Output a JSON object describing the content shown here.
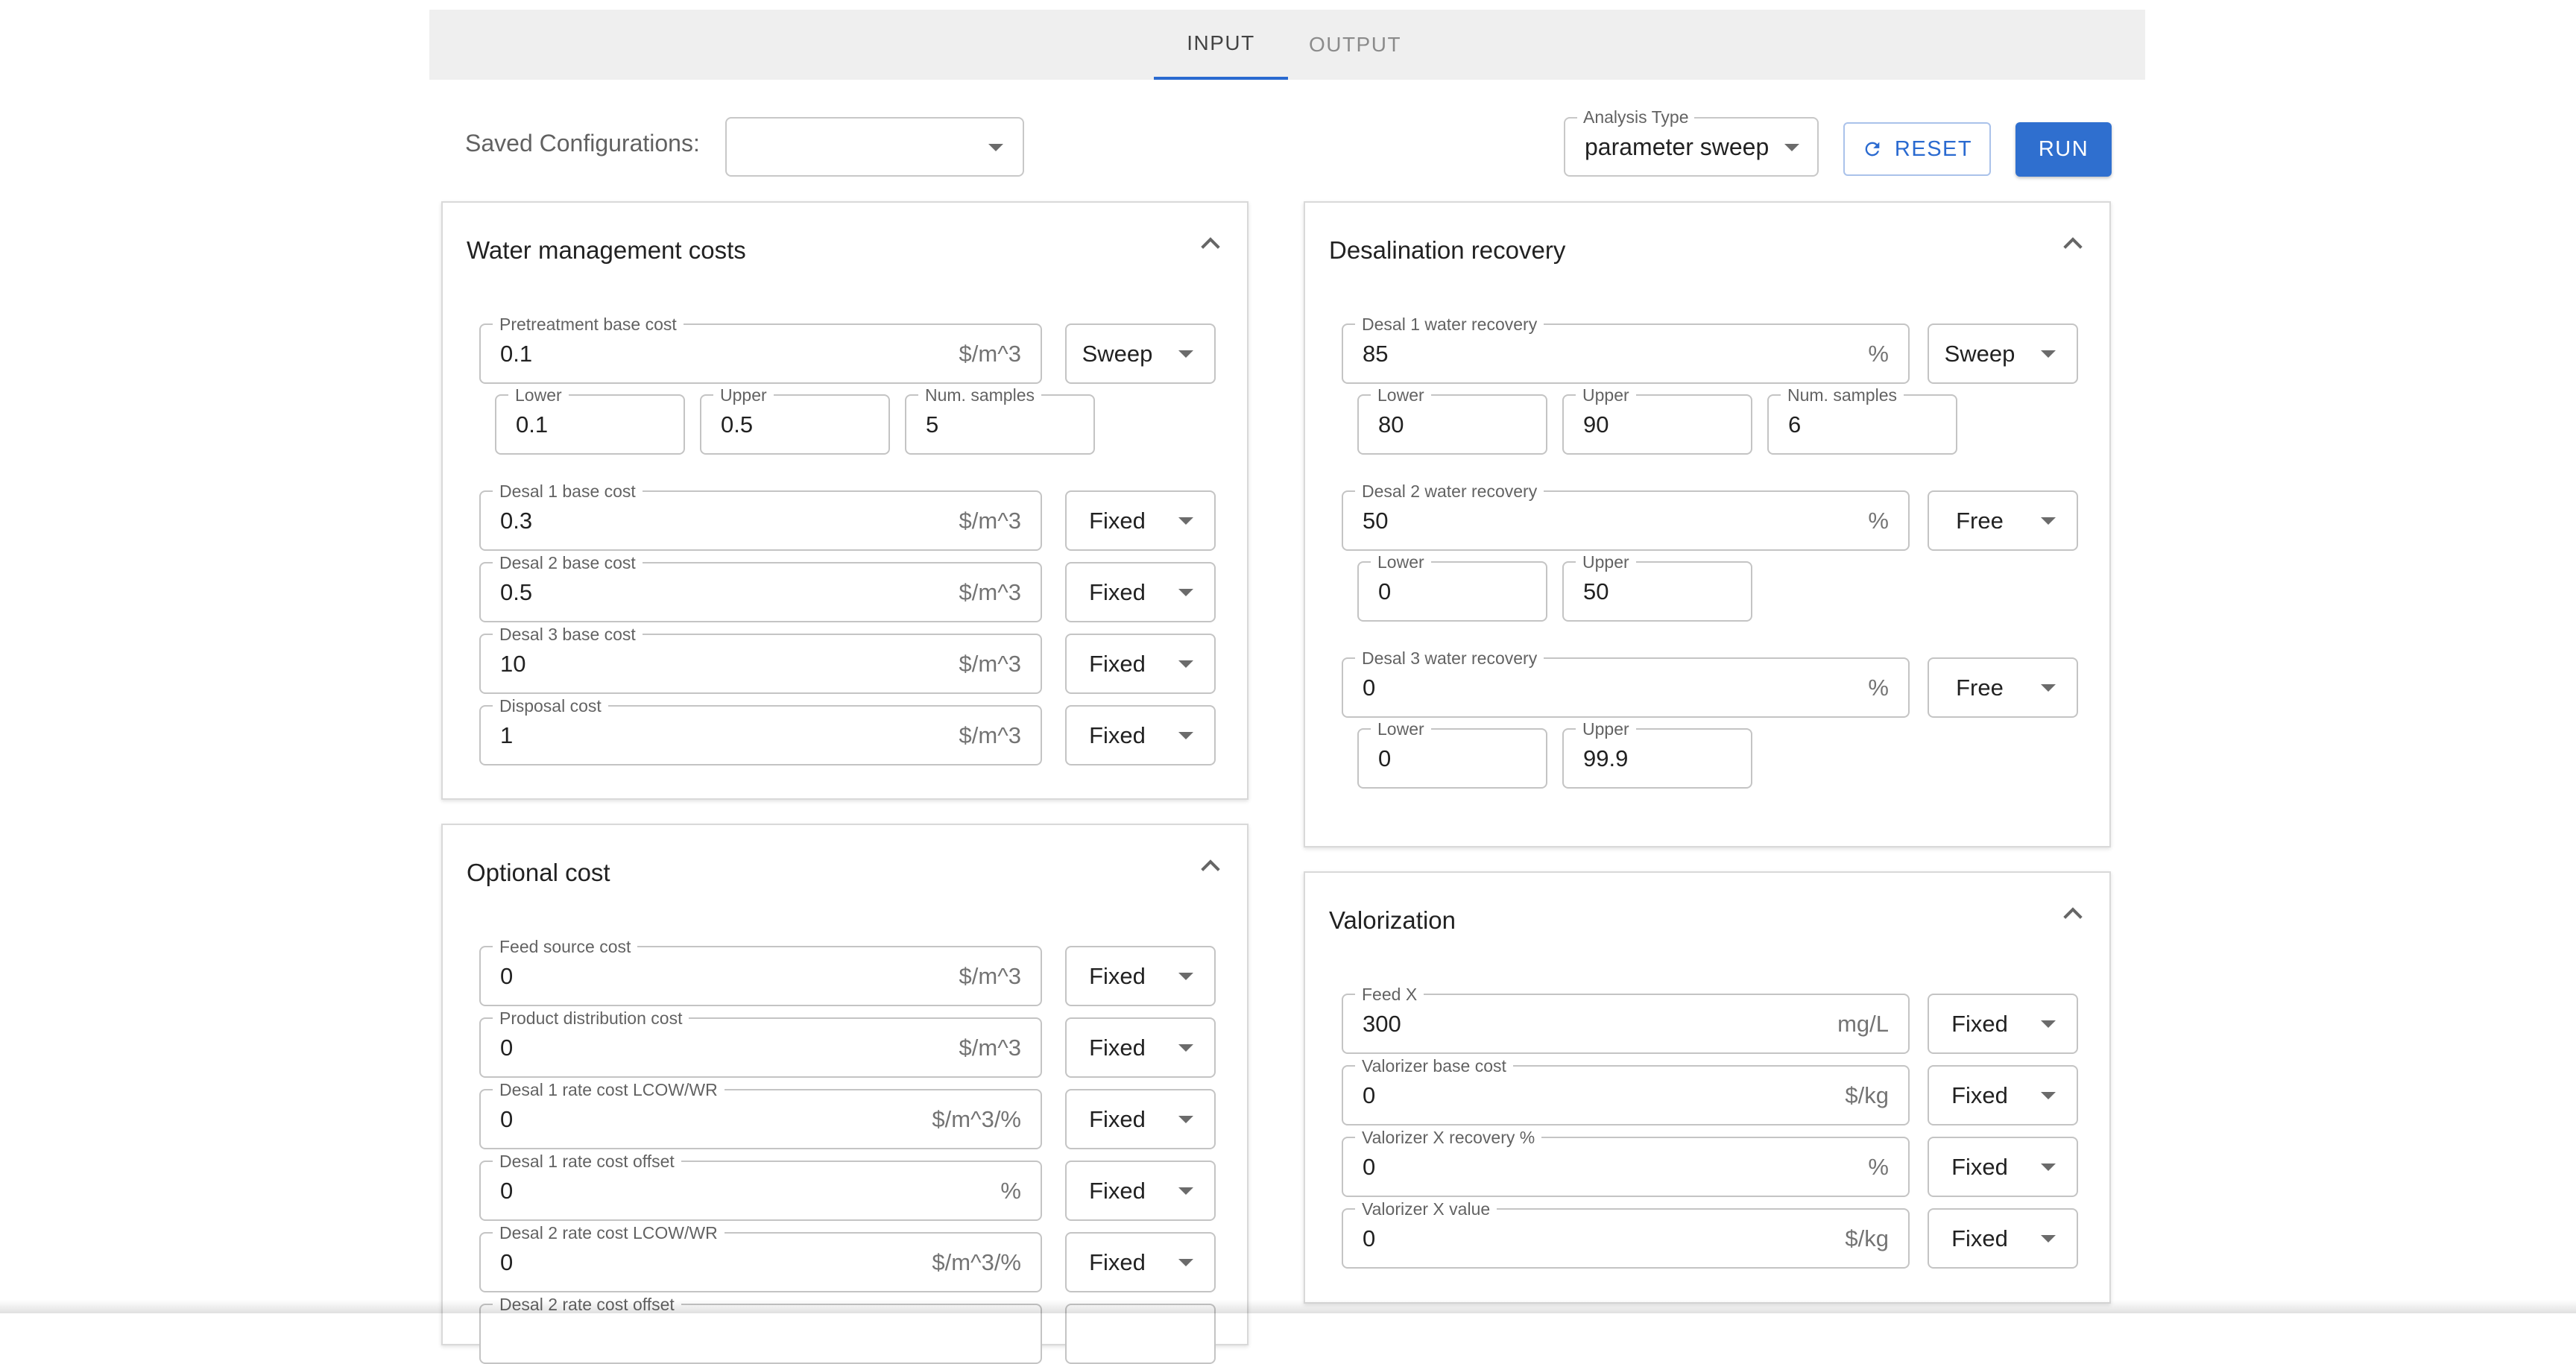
{
  "tabs": [
    {
      "label": "INPUT"
    },
    {
      "label": "OUTPUT"
    }
  ],
  "saved_configurations": {
    "label": "Saved Configurations:",
    "value": ""
  },
  "analysis_type": {
    "label": "Analysis Type",
    "value": "parameter sweep"
  },
  "buttons": {
    "reset": "RESET",
    "run": "RUN"
  },
  "colors": {
    "accent": "#2f6fcf",
    "tab_bar_bg": "#efefef"
  },
  "icons": {
    "reset": "refresh-icon",
    "dropdown": "caret-down-icon",
    "collapse": "chevron-up-icon"
  },
  "panels": {
    "water_management": {
      "title": "Water management costs",
      "pretreatment": {
        "label": "Pretreatment base cost",
        "value": "0.1",
        "unit": "$/m^3",
        "mode": "Sweep",
        "lower": {
          "label": "Lower",
          "value": "0.1"
        },
        "upper": {
          "label": "Upper",
          "value": "0.5"
        },
        "samples": {
          "label": "Num. samples",
          "value": "5"
        }
      },
      "desal1": {
        "label": "Desal 1 base cost",
        "value": "0.3",
        "unit": "$/m^3",
        "mode": "Fixed"
      },
      "desal2": {
        "label": "Desal 2 base cost",
        "value": "0.5",
        "unit": "$/m^3",
        "mode": "Fixed"
      },
      "desal3": {
        "label": "Desal 3 base cost",
        "value": "10",
        "unit": "$/m^3",
        "mode": "Fixed"
      },
      "disposal": {
        "label": "Disposal cost",
        "value": "1",
        "unit": "$/m^3",
        "mode": "Fixed"
      }
    },
    "optional_cost": {
      "title": "Optional cost",
      "feed_source": {
        "label": "Feed source cost",
        "value": "0",
        "unit": "$/m^3",
        "mode": "Fixed"
      },
      "product_distribution": {
        "label": "Product distribution cost",
        "value": "0",
        "unit": "$/m^3",
        "mode": "Fixed"
      },
      "desal1_rate": {
        "label": "Desal 1 rate cost LCOW/WR",
        "value": "0",
        "unit": "$/m^3/%",
        "mode": "Fixed"
      },
      "desal1_offset": {
        "label": "Desal 1 rate cost offset",
        "value": "0",
        "unit": "%",
        "mode": "Fixed"
      },
      "desal2_rate": {
        "label": "Desal 2 rate cost LCOW/WR",
        "value": "0",
        "unit": "$/m^3/%",
        "mode": "Fixed"
      },
      "desal2_offset": {
        "label": "Desal 2 rate cost offset"
      }
    },
    "desal_recovery": {
      "title": "Desalination recovery",
      "desal1": {
        "label": "Desal 1 water recovery",
        "value": "85",
        "unit": "%",
        "mode": "Sweep",
        "lower": {
          "label": "Lower",
          "value": "80"
        },
        "upper": {
          "label": "Upper",
          "value": "90"
        },
        "samples": {
          "label": "Num. samples",
          "value": "6"
        }
      },
      "desal2": {
        "label": "Desal 2 water recovery",
        "value": "50",
        "unit": "%",
        "mode": "Free",
        "lower": {
          "label": "Lower",
          "value": "0"
        },
        "upper": {
          "label": "Upper",
          "value": "50"
        }
      },
      "desal3": {
        "label": "Desal 3 water recovery",
        "value": "0",
        "unit": "%",
        "mode": "Free",
        "lower": {
          "label": "Lower",
          "value": "0"
        },
        "upper": {
          "label": "Upper",
          "value": "99.9"
        }
      }
    },
    "valorization": {
      "title": "Valorization",
      "feed_x": {
        "label": "Feed X",
        "value": "300",
        "unit": "mg/L",
        "mode": "Fixed"
      },
      "valorizer_base": {
        "label": "Valorizer base cost",
        "value": "0",
        "unit": "$/kg",
        "mode": "Fixed"
      },
      "valorizer_recovery": {
        "label": "Valorizer X recovery %",
        "value": "0",
        "unit": "%",
        "mode": "Fixed"
      },
      "valorizer_value": {
        "label": "Valorizer X value",
        "value": "0",
        "unit": "$/kg",
        "mode": "Fixed"
      }
    }
  }
}
